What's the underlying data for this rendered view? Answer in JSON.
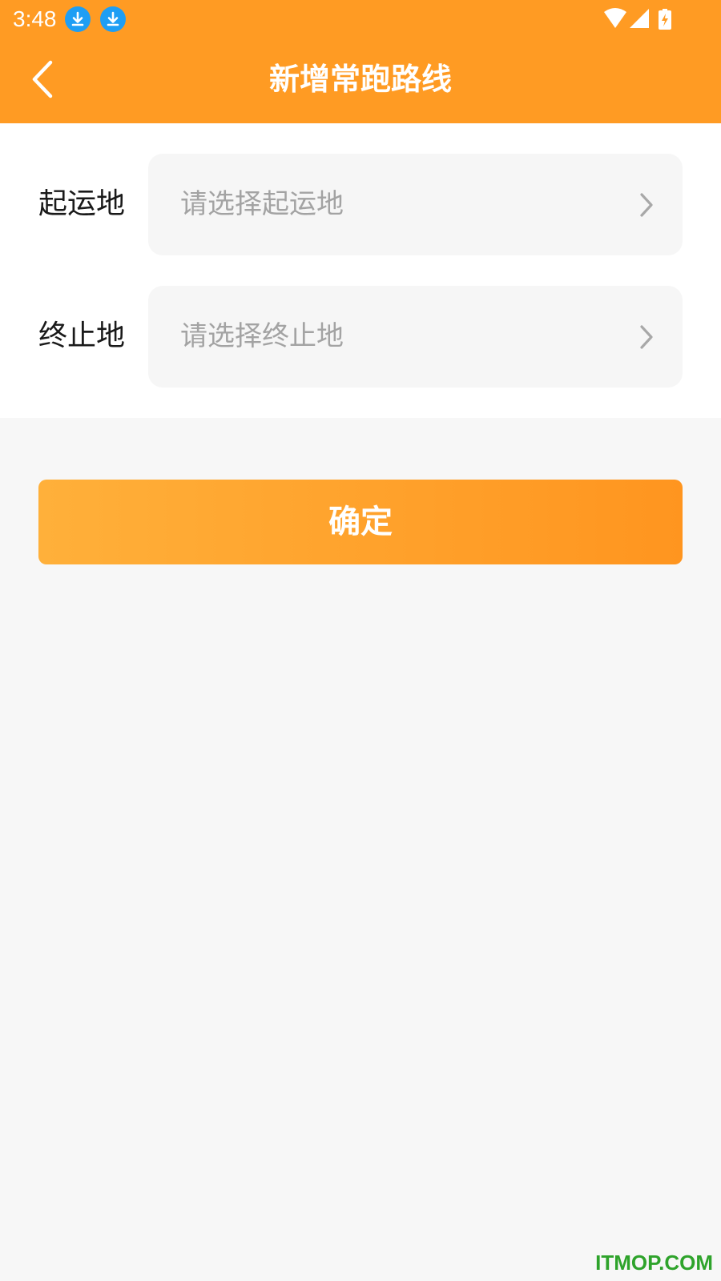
{
  "status_bar": {
    "time": "3:48",
    "icons": [
      "download-icon",
      "download-icon",
      "wifi-icon",
      "signal-icon",
      "battery-charging-icon"
    ]
  },
  "header": {
    "title": "新增常跑路线",
    "back_icon": "chevron-left-icon"
  },
  "form": {
    "origin": {
      "label": "起运地",
      "placeholder": "请选择起运地"
    },
    "destination": {
      "label": "终止地",
      "placeholder": "请选择终止地"
    }
  },
  "confirm_label": "确定",
  "watermark": "ITMOP.COM",
  "colors": {
    "header": "#ff9b23",
    "button_start": "#ffb03a",
    "button_end": "#ff951f",
    "background": "#f7f7f7",
    "field_bg": "#f6f6f6",
    "placeholder": "#a3a3a3",
    "download_badge": "#1e9ef4",
    "watermark": "#2ea32b"
  }
}
